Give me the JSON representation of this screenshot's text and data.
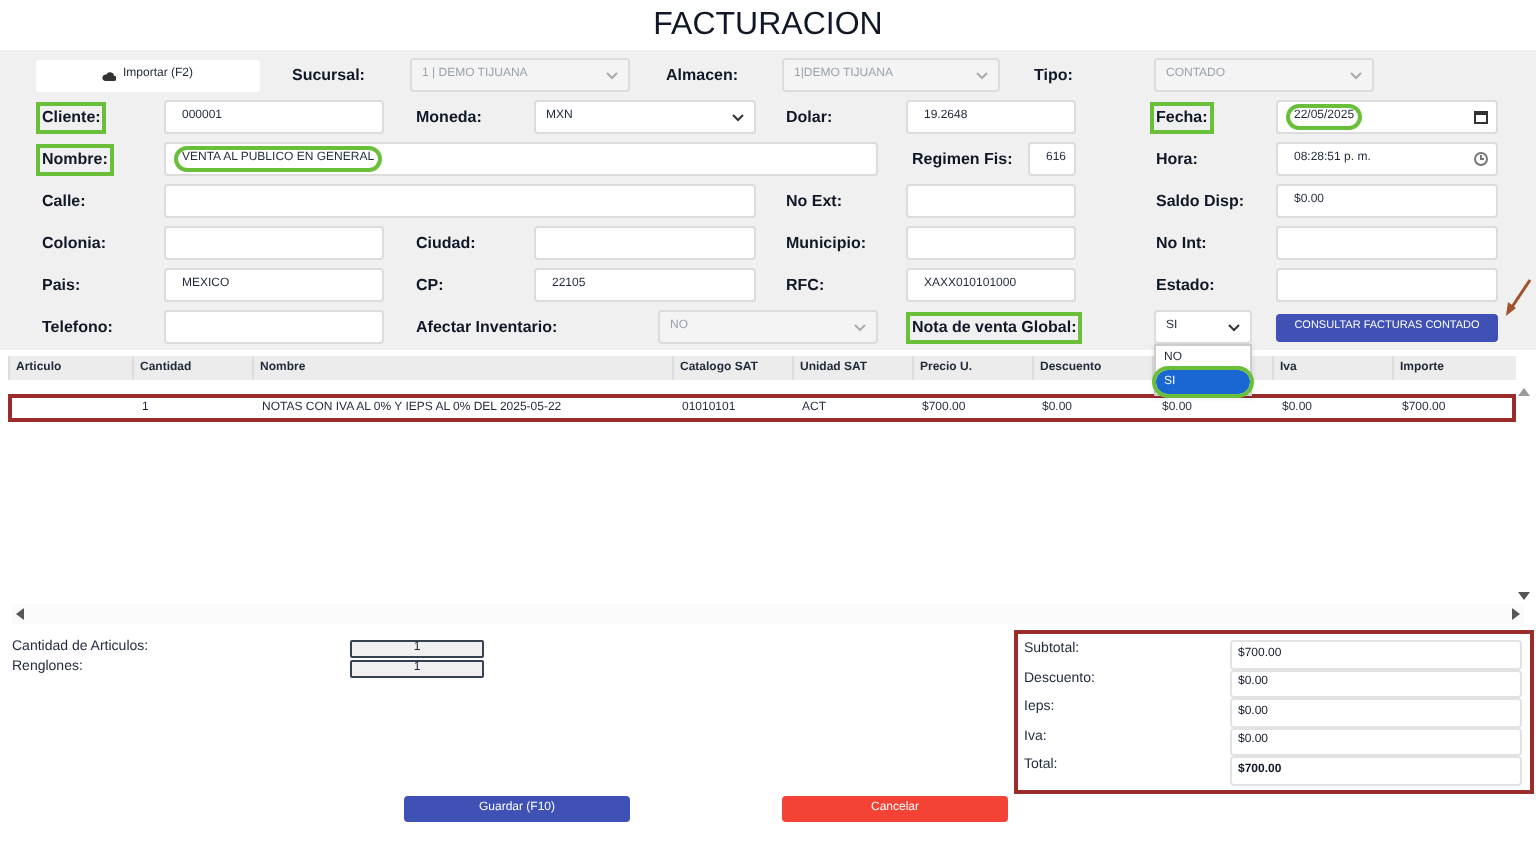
{
  "title": "FACTURACION",
  "form_rows": [
    [
      {
        "kind": "button",
        "text": "Importar (F2)"
      },
      {
        "kind": "label",
        "text": "Sucursal:",
        "highlighted": false
      },
      {
        "kind": "select",
        "value": "1 | DEMO TIJUANA",
        "disabled": true
      },
      {
        "kind": "label",
        "text": "Almacen:",
        "highlighted": false
      },
      {
        "kind": "select",
        "value": "1|DEMO TIJUANA",
        "disabled": true
      },
      {
        "kind": "label",
        "text": "Tipo:",
        "highlighted": false
      },
      {
        "kind": "select",
        "value": "CONTADO",
        "disabled": true
      }
    ],
    [
      {
        "kind": "label",
        "text": "Cliente:",
        "highlighted": true
      },
      {
        "kind": "input",
        "value": "000001",
        "circled": false
      },
      {
        "kind": "label",
        "text": "Moneda:",
        "highlighted": false
      },
      {
        "kind": "select",
        "value": "MXN",
        "disabled": false
      },
      {
        "kind": "label",
        "text": "Dolar:",
        "highlighted": false
      },
      {
        "kind": "input",
        "value": "19.2648",
        "circled": false
      },
      {
        "kind": "label",
        "text": "Fecha:",
        "highlighted": true
      },
      {
        "kind": "input",
        "value": "22/05/2025",
        "circled": true
      }
    ],
    [
      {
        "kind": "label",
        "text": "Nombre:",
        "highlighted": true
      },
      {
        "kind": "input",
        "value": "VENTA AL PUBLICO EN GENERAL",
        "circled": true
      },
      {
        "kind": "label",
        "text": "Regimen Fis:",
        "highlighted": false
      },
      {
        "kind": "input",
        "value": "616",
        "circled": false
      },
      {
        "kind": "label",
        "text": "Hora:",
        "highlighted": false
      },
      {
        "kind": "input",
        "value": "08:28:51 p. m.",
        "circled": false
      }
    ],
    [
      {
        "kind": "label",
        "text": "Calle:",
        "highlighted": false
      },
      {
        "kind": "input",
        "circled": false
      },
      {
        "kind": "label",
        "text": "No Ext:",
        "highlighted": false
      },
      {
        "kind": "input",
        "circled": false
      },
      {
        "kind": "label",
        "text": "Saldo Disp:",
        "highlighted": false
      },
      {
        "kind": "input",
        "value": "$0.00",
        "circled": false
      }
    ],
    [
      {
        "kind": "label",
        "text": "Colonia:",
        "highlighted": false
      },
      {
        "kind": "input",
        "circled": false
      },
      {
        "kind": "label",
        "text": "Ciudad:",
        "highlighted": false
      },
      {
        "kind": "input",
        "circled": false
      },
      {
        "kind": "label",
        "text": "Municipio:",
        "highlighted": false
      },
      {
        "kind": "input",
        "circled": false
      },
      {
        "kind": "label",
        "text": "No Int:",
        "highlighted": false
      },
      {
        "kind": "input",
        "circled": false
      }
    ],
    [
      {
        "kind": "label",
        "text": "Pais:",
        "highlighted": false
      },
      {
        "kind": "input",
        "value": "MEXICO",
        "circled": false
      },
      {
        "kind": "label",
        "text": "CP:",
        "highlighted": false
      },
      {
        "kind": "input",
        "value": "22105",
        "circled": false
      },
      {
        "kind": "label",
        "text": "RFC:",
        "highlighted": false
      },
      {
        "kind": "input",
        "value": "XAXX010101000",
        "circled": false
      },
      {
        "kind": "label",
        "text": "Estado:",
        "highlighted": false
      },
      {
        "kind": "input",
        "circled": false
      }
    ],
    [
      {
        "kind": "label",
        "text": "Telefono:",
        "highlighted": false
      },
      {
        "kind": "input",
        "circled": false
      },
      {
        "kind": "label",
        "text": "Afectar Inventario:",
        "highlighted": false
      },
      {
        "kind": "select",
        "value": "NO",
        "disabled": true
      },
      {
        "kind": "label",
        "text": "Nota de venta Global:",
        "highlighted": true
      },
      {
        "kind": "select",
        "value": "SI",
        "disabled": false,
        "open": true
      },
      {
        "kind": "button",
        "text": "CONSULTAR FACTURAS CONTADO"
      }
    ]
  ],
  "dropdown_options": [
    {
      "text": "NO",
      "selected": false,
      "circled": false
    },
    {
      "text": "SI",
      "selected": true,
      "circled": true
    }
  ],
  "table": {
    "columns": [
      {
        "label": "Articulo"
      },
      {
        "label": "Cantidad"
      },
      {
        "label": "Nombre"
      },
      {
        "label": "Catalogo SAT"
      },
      {
        "label": "Unidad SAT"
      },
      {
        "label": "Precio U."
      },
      {
        "label": "Descuento"
      },
      {},
      {
        "label": "Iva"
      },
      {
        "label": "Importe"
      }
    ],
    "rows": [
      {
        "outlined": true,
        "cells": [
          null,
          "1",
          "NOTAS CON IVA AL 0% Y IEPS AL 0% DEL 2025-05-22",
          "01010101",
          "ACT",
          "$700.00",
          "$0.00",
          "$0.00",
          "$0.00",
          "$700.00"
        ]
      }
    ]
  },
  "summary": [
    {
      "label": "Cantidad de Articulos:",
      "value": "1"
    },
    {
      "label": "Renglones:",
      "value": "1"
    }
  ],
  "totals": {
    "outlined": true,
    "rows": [
      {
        "label": "Subtotal:",
        "value": "$700.00",
        "bold": false
      },
      {
        "label": "Descuento:",
        "value": "$0.00",
        "bold": false
      },
      {
        "label": "Ieps:",
        "value": "$0.00",
        "bold": false
      },
      {
        "label": "Iva:",
        "value": "$0.00",
        "bold": false
      },
      {
        "label": "Total:",
        "value": "$700.00",
        "bold": true
      }
    ]
  },
  "buttons": [
    {
      "kind": "save",
      "text": "Guardar (F10)"
    },
    {
      "kind": "cancel",
      "text": "Cancelar"
    }
  ],
  "annotation_arrow": true
}
